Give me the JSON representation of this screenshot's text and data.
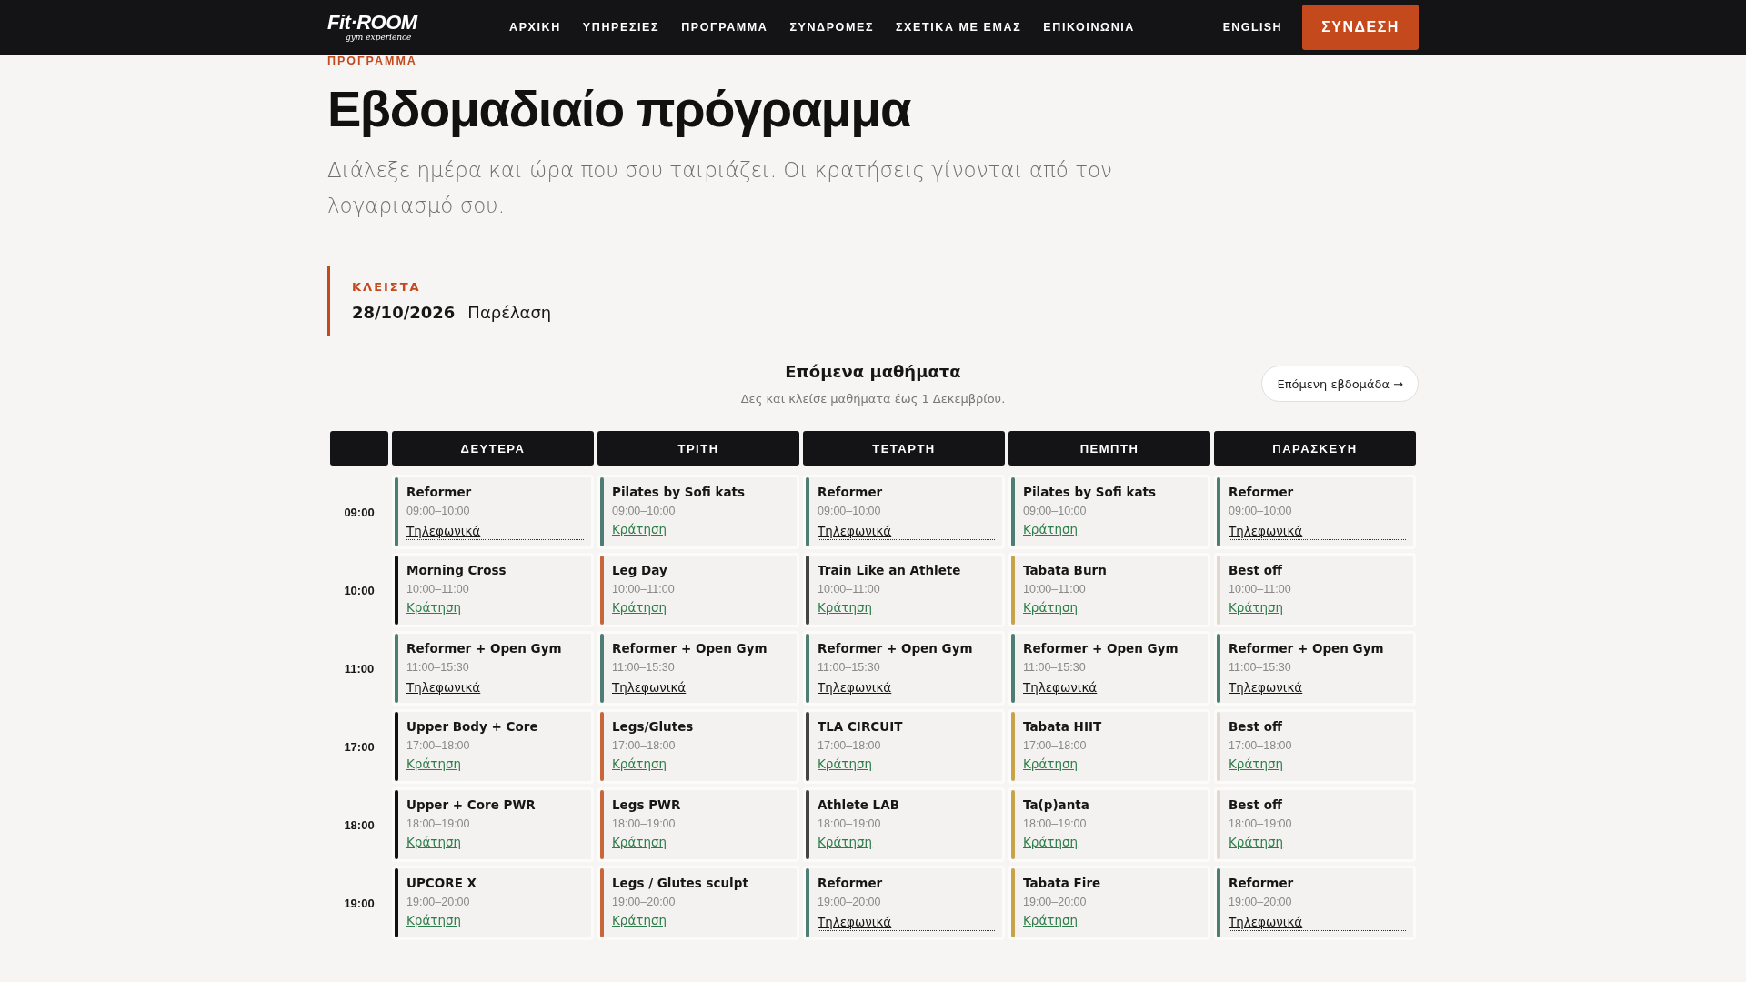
{
  "header": {
    "logo": {
      "brand": "Fit·ROOM",
      "tagline": "gym experience"
    },
    "nav": [
      {
        "label": "ΑΡΧΙΚΗ",
        "selected": false
      },
      {
        "label": "ΥΠΗΡΕΣΙΕΣ",
        "selected": false
      },
      {
        "label": "ΠΡΟΓΡΑΜΜΑ",
        "selected": false
      },
      {
        "label": "ΣΥΝΔΡΟΜΕΣ",
        "selected": false
      },
      {
        "label": "ΣΧΕΤΙΚΑ ΜΕ ΕΜΑΣ",
        "selected": false
      },
      {
        "label": "ΕΠΙΚΟΙΝΩΝΙΑ",
        "selected": false
      }
    ],
    "language": "ENGLISH",
    "login": "ΣΥΝΔΕΣΗ"
  },
  "page": {
    "kicker": "ΠΡΟΓΡΑΜΜΑ",
    "title": "Εβδομαδιαίο πρόγραμμα",
    "intro": "Διάλεξε ημέρα και ώρα που σου ταιριάζει. Οι κρατήσεις γίνονται από τον λογαριασμό σου."
  },
  "closed": {
    "label": "ΚΛΕΙΣΤΑ",
    "date": "28/10/2026",
    "reason": "Παρέλαση"
  },
  "schedule": {
    "title": "Επόμενα μαθήματα",
    "subtitle": "Δες και κλείσε μαθήματα έως 1 Δεκεμβρίου.",
    "next_button": "Επόμενη εβδομάδα →",
    "days": [
      "ΔΕΥΤΕΡΑ",
      "ΤΡΙΤΗ",
      "ΤΕΤΑΡΤΗ",
      "ΠΕΜΠΤΗ",
      "ΠΑΡΑΣΚΕΥΗ"
    ],
    "rows": [
      {
        "time": "09:00",
        "cells": [
          {
            "name": "Reformer",
            "hours": "09:00–10:00",
            "color": "#4f7d73",
            "action": {
              "kind": "phone",
              "label": "Τηλεφωνικά"
            }
          },
          {
            "name": "Pilates by Sofi kats",
            "hours": "09:00–10:00",
            "color": "#4f7d73",
            "action": {
              "kind": "book",
              "label": "Κράτηση"
            }
          },
          {
            "name": "Reformer",
            "hours": "09:00–10:00",
            "color": "#4f7d73",
            "action": {
              "kind": "phone",
              "label": "Τηλεφωνικά"
            }
          },
          {
            "name": "Pilates by Sofi kats",
            "hours": "09:00–10:00",
            "color": "#4f7d73",
            "action": {
              "kind": "book",
              "label": "Κράτηση"
            }
          },
          {
            "name": "Reformer",
            "hours": "09:00–10:00",
            "color": "#4f7d73",
            "action": {
              "kind": "phone",
              "label": "Τηλεφωνικά"
            }
          }
        ]
      },
      {
        "time": "10:00",
        "cells": [
          {
            "name": "Morning Cross",
            "hours": "10:00–11:00",
            "color": "#111111",
            "action": {
              "kind": "book",
              "label": "Κράτηση"
            }
          },
          {
            "name": "Leg Day",
            "hours": "10:00–11:00",
            "color": "#c9653b",
            "action": {
              "kind": "book",
              "label": "Κράτηση"
            }
          },
          {
            "name": "Train Like an Athlete",
            "hours": "10:00–11:00",
            "color": "#444444",
            "action": {
              "kind": "book",
              "label": "Κράτηση"
            }
          },
          {
            "name": "Tabata Burn",
            "hours": "10:00–11:00",
            "color": "#c9a347",
            "action": {
              "kind": "book",
              "label": "Κράτηση"
            }
          },
          {
            "name": "Best off",
            "hours": "10:00–11:00",
            "color": "#e2d8ce",
            "action": {
              "kind": "book",
              "label": "Κράτηση"
            }
          }
        ]
      },
      {
        "time": "11:00",
        "cells": [
          {
            "name": "Reformer + Open Gym",
            "hours": "11:00–15:30",
            "color": "#4f7d73",
            "action": {
              "kind": "phone",
              "label": "Τηλεφωνικά"
            }
          },
          {
            "name": "Reformer + Open Gym",
            "hours": "11:00–15:30",
            "color": "#4f7d73",
            "action": {
              "kind": "phone",
              "label": "Τηλεφωνικά"
            }
          },
          {
            "name": "Reformer + Open Gym",
            "hours": "11:00–15:30",
            "color": "#4f7d73",
            "action": {
              "kind": "phone",
              "label": "Τηλεφωνικά"
            }
          },
          {
            "name": "Reformer + Open Gym",
            "hours": "11:00–15:30",
            "color": "#4f7d73",
            "action": {
              "kind": "phone",
              "label": "Τηλεφωνικά"
            }
          },
          {
            "name": "Reformer + Open Gym",
            "hours": "11:00–15:30",
            "color": "#4f7d73",
            "action": {
              "kind": "phone",
              "label": "Τηλεφωνικά"
            }
          }
        ]
      },
      {
        "time": "17:00",
        "cells": [
          {
            "name": "Upper Body + Core",
            "hours": "17:00–18:00",
            "color": "#111111",
            "action": {
              "kind": "book",
              "label": "Κράτηση"
            }
          },
          {
            "name": "Legs/Glutes",
            "hours": "17:00–18:00",
            "color": "#c9653b",
            "action": {
              "kind": "book",
              "label": "Κράτηση"
            }
          },
          {
            "name": "TLA CIRCUIT",
            "hours": "17:00–18:00",
            "color": "#444444",
            "action": {
              "kind": "book",
              "label": "Κράτηση"
            }
          },
          {
            "name": "Tabata HIIT",
            "hours": "17:00–18:00",
            "color": "#c9a347",
            "action": {
              "kind": "book",
              "label": "Κράτηση"
            }
          },
          {
            "name": "Best off",
            "hours": "17:00–18:00",
            "color": "#e2d8ce",
            "action": {
              "kind": "book",
              "label": "Κράτηση"
            }
          }
        ]
      },
      {
        "time": "18:00",
        "cells": [
          {
            "name": "Upper + Core PWR",
            "hours": "18:00–19:00",
            "color": "#111111",
            "action": {
              "kind": "book",
              "label": "Κράτηση"
            }
          },
          {
            "name": "Legs PWR",
            "hours": "18:00–19:00",
            "color": "#c9653b",
            "action": {
              "kind": "book",
              "label": "Κράτηση"
            }
          },
          {
            "name": "Athlete LAB",
            "hours": "18:00–19:00",
            "color": "#444444",
            "action": {
              "kind": "book",
              "label": "Κράτηση"
            }
          },
          {
            "name": "Ta(p)anta",
            "hours": "18:00–19:00",
            "color": "#c9a347",
            "action": {
              "kind": "book",
              "label": "Κράτηση"
            }
          },
          {
            "name": "Best off",
            "hours": "18:00–19:00",
            "color": "#e2d8ce",
            "action": {
              "kind": "book",
              "label": "Κράτηση"
            }
          }
        ]
      },
      {
        "time": "19:00",
        "cells": [
          {
            "name": "UPCORE X",
            "hours": "19:00–20:00",
            "color": "#111111",
            "action": {
              "kind": "book",
              "label": "Κράτηση"
            }
          },
          {
            "name": "Legs / Glutes sculpt",
            "hours": "19:00–20:00",
            "color": "#c9653b",
            "action": {
              "kind": "book",
              "label": "Κράτηση"
            }
          },
          {
            "name": "Reformer",
            "hours": "19:00–20:00",
            "color": "#4f7d73",
            "action": {
              "kind": "phone",
              "label": "Τηλεφωνικά"
            }
          },
          {
            "name": "Tabata Fire",
            "hours": "19:00–20:00",
            "color": "#c9a347",
            "action": {
              "kind": "book",
              "label": "Κράτηση"
            }
          },
          {
            "name": "Reformer",
            "hours": "19:00–20:00",
            "color": "#4f7d73",
            "action": {
              "kind": "phone",
              "label": "Τηλεφωνικά"
            }
          }
        ]
      }
    ]
  }
}
